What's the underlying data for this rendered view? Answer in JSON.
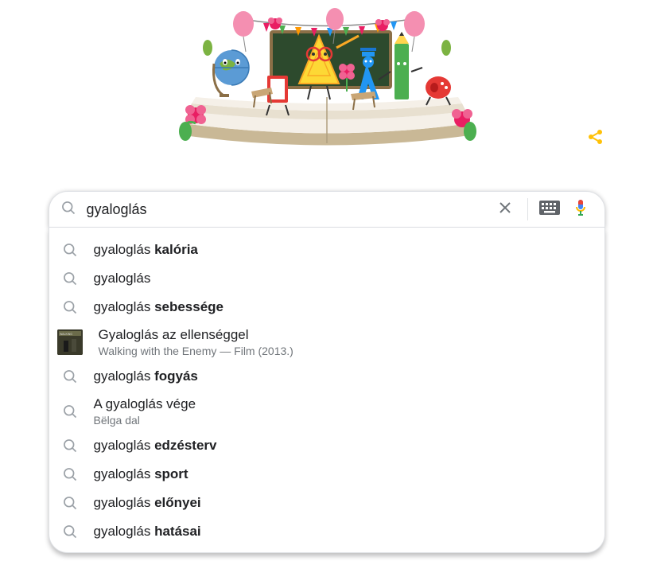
{
  "search": {
    "query": "gyaloglás",
    "placeholder": ""
  },
  "suggestions": [
    {
      "prefix": "gyaloglás ",
      "completion": "kalória",
      "sub": null,
      "icon": "search"
    },
    {
      "prefix": "gyaloglás",
      "completion": "",
      "sub": null,
      "icon": "search"
    },
    {
      "prefix": "gyaloglás ",
      "completion": "sebessége",
      "sub": null,
      "icon": "search"
    },
    {
      "prefix": "Gyaloglás az ellenséggel",
      "completion": "",
      "sub": "Walking with the Enemy — Film (2013.)",
      "icon": "thumb"
    },
    {
      "prefix": "gyaloglás ",
      "completion": "fogyás",
      "sub": null,
      "icon": "search"
    },
    {
      "prefix": "A gyaloglás vége",
      "completion": "",
      "sub": "Bëlga dal",
      "icon": "search"
    },
    {
      "prefix": "gyaloglás ",
      "completion": "edzésterv",
      "sub": null,
      "icon": "search"
    },
    {
      "prefix": "gyaloglás ",
      "completion": "sport",
      "sub": null,
      "icon": "search"
    },
    {
      "prefix": "gyaloglás ",
      "completion": "előnyei",
      "sub": null,
      "icon": "search"
    },
    {
      "prefix": "gyaloglás ",
      "completion": "hatásai",
      "sub": null,
      "icon": "search"
    }
  ]
}
